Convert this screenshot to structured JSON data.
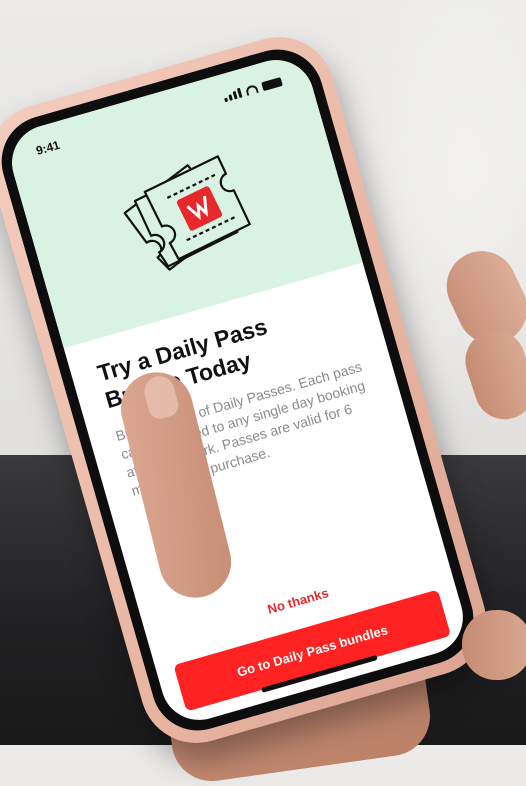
{
  "status_bar": {
    "time": "9:41"
  },
  "promo": {
    "illustration_icon": "ticket-icon",
    "title": "Try a Daily Pass Bundle Today",
    "body": "Buy a bundle of Daily Passes. Each pass can be applied to any single day booking at this car park. Passes are valid for 6 months from purchase."
  },
  "actions": {
    "dismiss_label": "No thanks",
    "primary_label": "Go to Daily Pass bundles"
  },
  "colors": {
    "accent": "#ff2222",
    "header_background": "#d9f2e4",
    "case": "#e9b5a3"
  }
}
